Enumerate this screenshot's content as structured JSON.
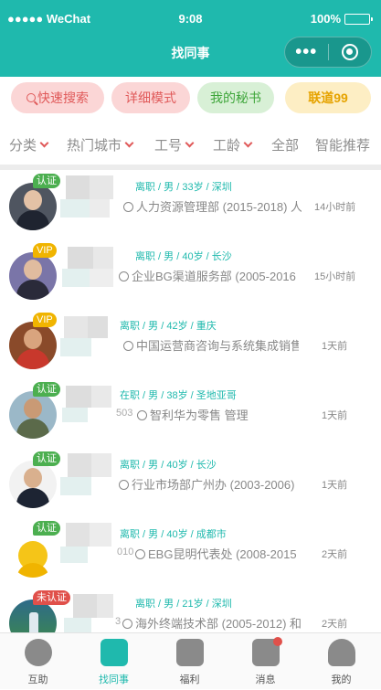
{
  "status_bar": {
    "carrier": "●●●●● WeChat",
    "time": "9:08",
    "battery": "100%"
  },
  "nav": {
    "title": "找同事",
    "more_label": "•••"
  },
  "quick_pills": [
    {
      "label": "快速搜索",
      "icon": "search-icon"
    },
    {
      "label": "详细模式"
    },
    {
      "label": "我的秘书"
    },
    {
      "label": "联道99"
    }
  ],
  "filters": [
    {
      "label": "分类",
      "has_arrow": true
    },
    {
      "label": "热门城市",
      "has_arrow": true
    },
    {
      "label": "工号",
      "has_arrow": true
    },
    {
      "label": "工龄",
      "has_arrow": true
    },
    {
      "label": "全部",
      "has_arrow": false
    },
    {
      "label": "智能推荐",
      "has_arrow": false
    }
  ],
  "people": [
    {
      "badge": "认证",
      "badge_type": "cert",
      "info": "离职 / 男 / 33岁 / 深圳",
      "dept": "人力资源管理部 (2015-2018) 人",
      "time": "14小时前"
    },
    {
      "badge": "VIP",
      "badge_type": "vip",
      "info": "离职 / 男 / 40岁 / 长沙",
      "dept": "企业BG渠道服务部 (2005-2016",
      "time": "15小时前"
    },
    {
      "badge": "VIP",
      "badge_type": "vip",
      "info": "离职 / 男 / 42岁 / 重庆",
      "dept": "中国运营商咨询与系统集成销售",
      "time": "1天前"
    },
    {
      "badge": "认证",
      "badge_type": "cert",
      "info": "在职 / 男 / 38岁 / 圣地亚哥",
      "id_fragment": "503",
      "dept": "智利华为零售 管理",
      "time": "1天前"
    },
    {
      "badge": "认证",
      "badge_type": "cert",
      "info": "离职 / 男 / 40岁 / 长沙",
      "dept": "行业市场部广州办 (2003-2006)",
      "time": "1天前"
    },
    {
      "badge": "认证",
      "badge_type": "cert",
      "info": "离职 / 男 / 40岁 / 成都市",
      "id_fragment": "010",
      "dept": "EBG昆明代表处 (2008-2015",
      "time": "2天前"
    },
    {
      "badge": "未认证",
      "badge_type": "uncert",
      "info": "离职 / 男 / 21岁 / 深圳",
      "id_fragment": "3",
      "dept": "海外终端技术部 (2005-2012) 和",
      "time": "2天前"
    }
  ],
  "tabs": [
    {
      "label": "互助",
      "icon": "handshake-icon"
    },
    {
      "label": "找同事",
      "icon": "colleague-icon",
      "active": true
    },
    {
      "label": "福利",
      "icon": "gift-icon"
    },
    {
      "label": "消息",
      "icon": "message-icon",
      "has_dot": true
    },
    {
      "label": "我的",
      "icon": "profile-icon"
    }
  ],
  "colors": {
    "primary": "#1fb9ad",
    "badge_cert": "#4caf50",
    "badge_vip": "#f0b400",
    "badge_uncert": "#e0504a"
  }
}
